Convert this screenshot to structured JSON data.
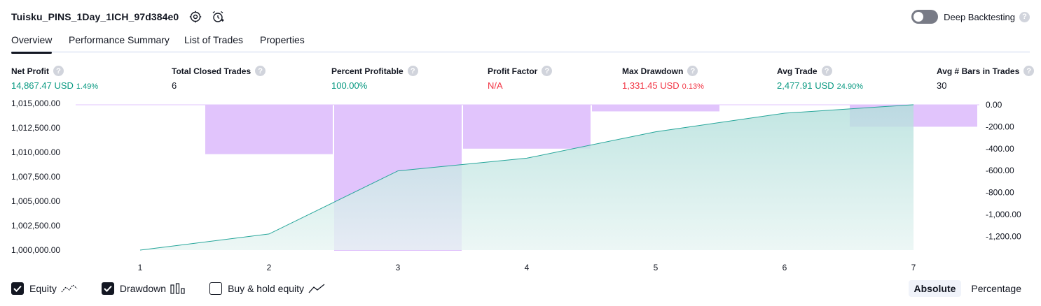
{
  "header": {
    "strategy_name": "Tuisku_PINS_1Day_1ICH_97d384e0",
    "deep_backtesting_label": "Deep Backtesting",
    "deep_backtesting_enabled": false
  },
  "tabs": [
    {
      "label": "Overview",
      "active": true
    },
    {
      "label": "Performance Summary",
      "active": false
    },
    {
      "label": "List of Trades",
      "active": false
    },
    {
      "label": "Properties",
      "active": false
    }
  ],
  "metrics": [
    {
      "label": "Net Profit",
      "value": "14,867.47 USD",
      "percent": "1.49%",
      "tone": "positive"
    },
    {
      "label": "Total Closed Trades",
      "value": "6",
      "percent": "",
      "tone": "neutral"
    },
    {
      "label": "Percent Profitable",
      "value": "100.00%",
      "percent": "",
      "tone": "positive"
    },
    {
      "label": "Profit Factor",
      "value": "N/A",
      "percent": "",
      "tone": "negative"
    },
    {
      "label": "Max Drawdown",
      "value": "1,331.45 USD",
      "percent": "0.13%",
      "tone": "negative"
    },
    {
      "label": "Avg Trade",
      "value": "2,477.91 USD",
      "percent": "24.90%",
      "tone": "positive"
    },
    {
      "label": "Avg # Bars in Trades",
      "value": "30",
      "percent": "",
      "tone": "neutral"
    }
  ],
  "chart_data": {
    "type": "area",
    "x": [
      1,
      2,
      3,
      4,
      5,
      6,
      7
    ],
    "series": [
      {
        "values": [
          1000000,
          1001650,
          1008100,
          1009400,
          1012100,
          1014000,
          1014867.47
        ],
        "axis": "left"
      },
      {
        "values": [
          0,
          -450,
          -1331.45,
          -400,
          -60,
          0,
          -200
        ],
        "axis": "right",
        "style": "bar"
      }
    ],
    "left_axis": {
      "ticks": [
        1000000,
        1002500,
        1005000,
        1007500,
        1010000,
        1012500,
        1015000
      ],
      "tick_labels": [
        "1,000,000.00",
        "1,002,500.00",
        "1,005,000.00",
        "1,007,500.00",
        "1,010,000.00",
        "1,012,500.00",
        "1,015,000.00"
      ],
      "range": [
        1000000,
        1015000
      ]
    },
    "right_axis": {
      "ticks": [
        0,
        -200,
        -400,
        -600,
        -800,
        -1000,
        -1200
      ],
      "tick_labels": [
        "0.00",
        "-200.00",
        "-400.00",
        "-600.00",
        "-800.00",
        "-1,000.00",
        "-1,200.00"
      ],
      "range": [
        -1331.45,
        0
      ]
    },
    "x_tick_labels": [
      "1",
      "2",
      "3",
      "4",
      "5",
      "6",
      "7"
    ],
    "colors": {
      "equity_line": "#26a69a",
      "equity_fill_top": "#b2dfdb",
      "equity_fill_bottom": "#e8f5f3",
      "drawdown_bar": "#e1c4fc",
      "zero_line": "#e1c4fc"
    }
  },
  "legend": [
    {
      "label": "Equity",
      "checked": true,
      "icon": "equity-line-icon"
    },
    {
      "label": "Drawdown",
      "checked": true,
      "icon": "drawdown-bars-icon"
    },
    {
      "label": "Buy & hold equity",
      "checked": false,
      "icon": "buy-hold-line-icon"
    }
  ],
  "mode": {
    "options": [
      "Absolute",
      "Percentage"
    ],
    "selected": "Absolute"
  },
  "icons": {
    "settings": "gear-icon",
    "alert": "add-alert-clock-icon",
    "help": "question-mark-icon"
  }
}
